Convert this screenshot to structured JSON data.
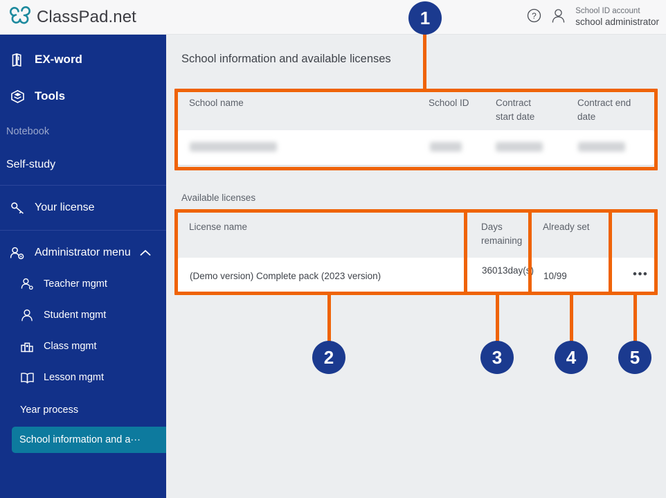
{
  "topbar": {
    "brand": "ClassPad.net",
    "logo_icon": "chain-link-logo-icon",
    "help_icon": "help-circle-icon",
    "user_icon": "user-icon",
    "account_type": "School ID account",
    "account_name": "school administrator"
  },
  "sidebar": {
    "items": [
      {
        "label": "EX-word",
        "icon": "book-icon",
        "style": "top"
      },
      {
        "label": "Tools",
        "icon": "toolbox-icon",
        "style": "top"
      },
      {
        "label": "Notebook",
        "icon": "none",
        "style": "dim"
      },
      {
        "label": "Self-study",
        "icon": "none",
        "style": "plain"
      },
      {
        "label": "Your license",
        "icon": "key-icon",
        "style": "top-light"
      }
    ],
    "admin": {
      "label": "Administrator menu",
      "icon": "user-gear-icon",
      "chevron": "chevron-up-icon",
      "subitems": [
        {
          "label": "Teacher mgmt",
          "icon": "teacher-icon"
        },
        {
          "label": "Student mgmt",
          "icon": "student-icon"
        },
        {
          "label": "Class mgmt",
          "icon": "class-icon"
        },
        {
          "label": "Lesson mgmt",
          "icon": "book-open-icon"
        }
      ],
      "year_process": "Year process",
      "selected": "School information and a···"
    }
  },
  "main": {
    "page_title": "School information and available licenses",
    "school_table": {
      "columns": [
        "School name",
        "School ID",
        "Contract start date",
        "Contract end date"
      ],
      "rows": [
        {
          "school_name": "",
          "school_id": "",
          "contract_start": "",
          "contract_end": ""
        }
      ],
      "redacted": true
    },
    "licenses_label": "Available licenses",
    "license_table": {
      "columns": [
        "License name",
        "Days remaining",
        "Already set",
        ""
      ],
      "rows": [
        {
          "license_name": "(Demo version) Complete pack (2023 version)",
          "days_remaining": "36013day(s)",
          "already_set": "10/99",
          "menu": "•••"
        }
      ]
    }
  },
  "annotations": {
    "accent_color": "#ef6307",
    "badge_color": "#1b3a8f",
    "badges": [
      {
        "number": "1"
      },
      {
        "number": "2"
      },
      {
        "number": "3"
      },
      {
        "number": "4"
      },
      {
        "number": "5"
      }
    ]
  },
  "colors": {
    "sidebar_bg": "#123189",
    "selected_bg": "#0d7a9e",
    "content_bg": "#eceef0",
    "topbar_bg": "#f7f7f8"
  }
}
